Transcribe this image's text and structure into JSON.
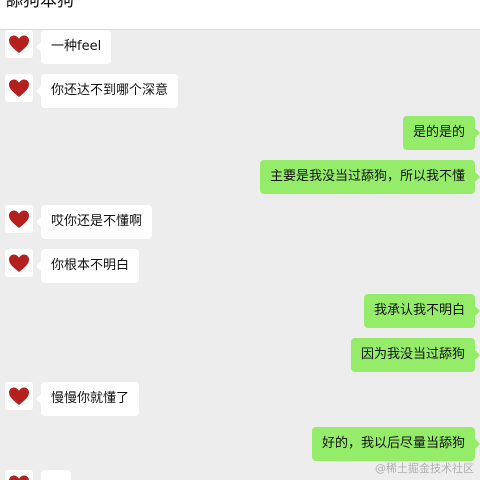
{
  "header": {
    "title": "舔狗本狗"
  },
  "messages": [
    {
      "side": "in",
      "text": "一种feel"
    },
    {
      "side": "in",
      "text": "你还达不到哪个深意"
    },
    {
      "side": "out",
      "text": "是的是的"
    },
    {
      "side": "out",
      "text": "主要是我没当过舔狗，所以我不懂"
    },
    {
      "side": "in",
      "text": "哎你还是不懂啊"
    },
    {
      "side": "in",
      "text": "你根本不明白"
    },
    {
      "side": "out",
      "text": "我承认我不明白"
    },
    {
      "side": "out",
      "text": "因为我没当过舔狗"
    },
    {
      "side": "in",
      "text": "慢慢你就懂了"
    },
    {
      "side": "out",
      "text": "好的，我以后尽量当舔狗"
    },
    {
      "side": "in",
      "text": ""
    }
  ],
  "avatar_icon": "red-heart-icon",
  "colors": {
    "outgoing_bubble": "#95ec69",
    "incoming_bubble": "#ffffff",
    "background": "#ededed",
    "heart": "#b3201d"
  },
  "watermark": "@稀土掘金技术社区"
}
